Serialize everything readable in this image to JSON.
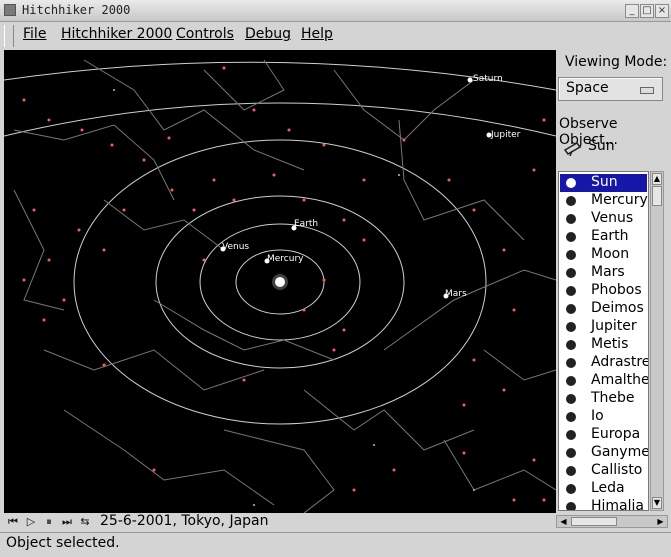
{
  "window": {
    "title": "Hitchhiker 2000"
  },
  "menu": [
    "File",
    "Hitchhiker 2000",
    "Controls",
    "Debug",
    "Help"
  ],
  "side": {
    "viewing_mode_label": "Viewing Mode:",
    "viewing_mode_value": "Space",
    "observe_label": "Observe Object...",
    "observe_value": "Sun",
    "objects": [
      "Sun",
      "Mercury",
      "Venus",
      "Earth",
      "Moon",
      "Mars",
      "Phobos",
      "Deimos",
      "Jupiter",
      "Metis",
      "Adrastrea",
      "Amalthea",
      "Thebe",
      "Io",
      "Europa",
      "Ganymede",
      "Callisto",
      "Leda",
      "Himalia"
    ],
    "selected_index": 0
  },
  "space": {
    "bodies": [
      "Saturn",
      "Jupiter",
      "Earth",
      "Venus",
      "Mercury",
      "Mars"
    ]
  },
  "timebar": {
    "date": "25-6-2001, Tokyo, Japan"
  },
  "status": {
    "text": "Object selected."
  },
  "colors": {
    "star_red": "#ff5a5a",
    "selection_blue": "#1616a8"
  }
}
